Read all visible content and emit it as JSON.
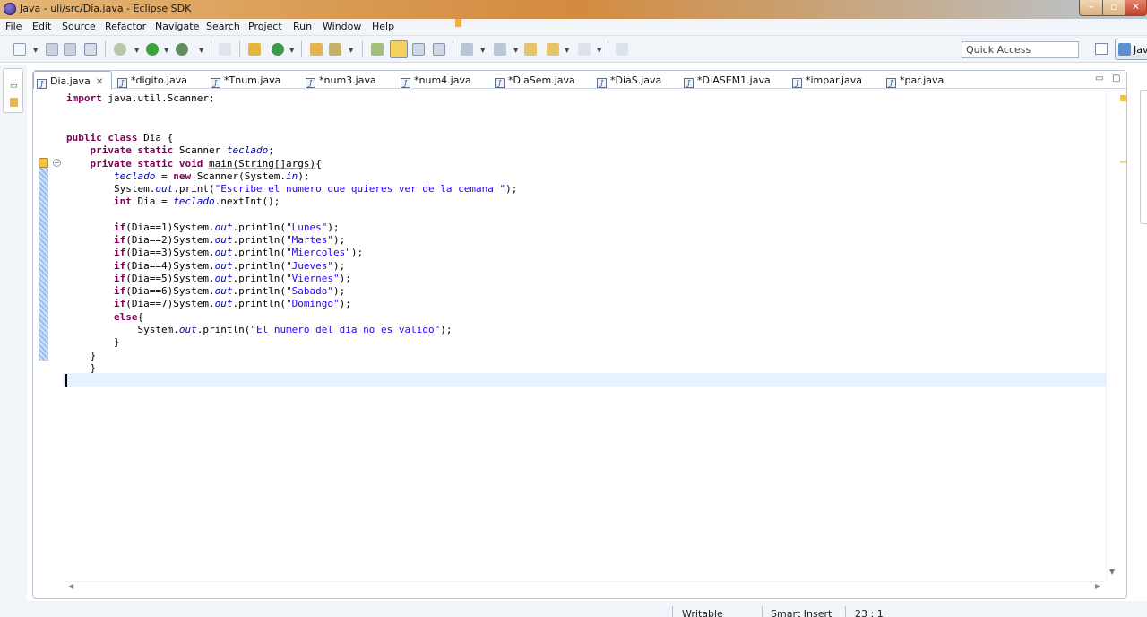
{
  "window": {
    "title": "Java - uli/src/Dia.java - Eclipse SDK"
  },
  "menu": [
    "File",
    "Edit",
    "Source",
    "Refactor",
    "Navigate",
    "Search",
    "Project",
    "Run",
    "Window",
    "Help"
  ],
  "toolbar": {
    "quick_access": "Quick Access",
    "perspective_label": "Java",
    "buttons": [
      "new-icon",
      "save-icon",
      "save-all-icon",
      "print-icon",
      "debug-icon",
      "run-icon",
      "external-tools-icon",
      "toggle-breadcrumb-icon",
      "new-java-project-icon",
      "new-class-icon",
      "open-type-icon",
      "search-icon",
      "mark-occurrences-icon",
      "block-selection-icon",
      "show-whitespace-icon",
      "next-annotation-icon",
      "previous-annotation-icon",
      "last-edit-icon",
      "back-icon",
      "forward-icon",
      "pin-editor-icon"
    ]
  },
  "tabs": [
    {
      "label": "Dia.java",
      "active": true
    },
    {
      "label": "*digito.java"
    },
    {
      "label": "*Tnum.java"
    },
    {
      "label": "*num3.java"
    },
    {
      "label": "*num4.java"
    },
    {
      "label": "*DiaSem.java"
    },
    {
      "label": "*DiaS.java"
    },
    {
      "label": "*DIASEM1.java"
    },
    {
      "label": "*impar.java"
    },
    {
      "label": "*par.java"
    }
  ],
  "code": {
    "l1": {
      "kw": "import",
      "rest": " java.util.Scanner;"
    },
    "l4": {
      "kw": "public class",
      "rest": " Dia {"
    },
    "l5": {
      "kw": "private static",
      "mid": " Scanner ",
      "fld": "teclado",
      "end": ";"
    },
    "l6": {
      "kw": "private static void",
      "sp": " ",
      "mth": "main(String[]args)",
      "end": "{"
    },
    "l7": {
      "fld": "teclado",
      "a": " = ",
      "kw": "new",
      "b": " Scanner(System.",
      "fld2": "in",
      "c": ");"
    },
    "l8": {
      "a": "System.",
      "fld": "out",
      "b": ".print(",
      "str": "\"Escribe el numero que quieres ver de la cemana \"",
      "c": ");"
    },
    "l9": {
      "kw": "int",
      "a": " Dia = ",
      "fld": "teclado",
      "b": ".nextInt();"
    },
    "ifs": [
      {
        "kw": "if",
        "a": "(Dia==1)System.",
        "fld": "out",
        "b": ".println(",
        "str": "\"Lunes\"",
        "c": ");"
      },
      {
        "kw": "if",
        "a": "(Dia==2)System.",
        "fld": "out",
        "b": ".println(",
        "str": "\"Martes\"",
        "c": ");"
      },
      {
        "kw": "if",
        "a": "(Dia==3)System.",
        "fld": "out",
        "b": ".println(",
        "str": "\"Miercoles\"",
        "c": ");"
      },
      {
        "kw": "if",
        "a": "(Dia==4)System.",
        "fld": "out",
        "b": ".println(",
        "str": "\"Jueves\"",
        "c": ");"
      },
      {
        "kw": "if",
        "a": "(Dia==5)System.",
        "fld": "out",
        "b": ".println(",
        "str": "\"Viernes\"",
        "c": ");"
      },
      {
        "kw": "if",
        "a": "(Dia==6)System.",
        "fld": "out",
        "b": ".println(",
        "str": "\"Sabado\"",
        "c": ");"
      },
      {
        "kw": "if",
        "a": "(Dia==7)System.",
        "fld": "out",
        "b": ".println(",
        "str": "\"Domingo\"",
        "c": ");"
      }
    ],
    "l18": {
      "kw": "else",
      "rest": "{"
    },
    "l19": {
      "a": "System.",
      "fld": "out",
      "b": ".println(",
      "str": "\"El numero del dia no es valido\"",
      "c": ");"
    },
    "close": "}"
  },
  "status": {
    "writable": "Writable",
    "insert_mode": "Smart Insert",
    "position": "23 : 1"
  },
  "colors": {
    "keyword": "#7f0055",
    "string": "#2a00ff",
    "field": "#0000c0",
    "current_line": "#e8f2fe"
  }
}
